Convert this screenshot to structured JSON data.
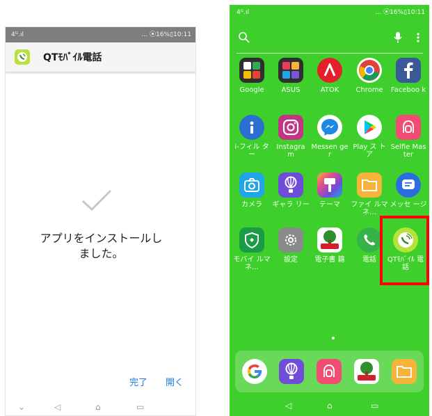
{
  "left": {
    "status_left": "4ᴳ.ıl",
    "status_right": "… ⦿16%▯10:11",
    "app_title": "QTﾓﾊﾞｲﾙ電話",
    "message_line1": "アプリをインストールし",
    "message_line2": "ました。",
    "done_label": "完了",
    "open_label": "開く",
    "nav": [
      "⌄",
      "◁",
      "⌂",
      "▭"
    ]
  },
  "right": {
    "status_left": "4ᴳ.ıl",
    "status_right": "… ⦿16%▯10:11",
    "apps": [
      {
        "label": "Google",
        "color": "#2f2f2f",
        "icon": "google-folder-icon"
      },
      {
        "label": "ASUS",
        "color": "#2f2f2f",
        "icon": "asus-folder-icon"
      },
      {
        "label": "ATOK",
        "color": "#e4202d",
        "icon": "atok-icon"
      },
      {
        "label": "Chrome",
        "color": "#ffffff",
        "icon": "chrome-icon"
      },
      {
        "label": "Faceboo k",
        "color": "#3b5998",
        "icon": "facebook-icon"
      },
      {
        "label": "i-フィル ター",
        "color": "#2b6fd1",
        "icon": "i-filter-icon"
      },
      {
        "label": "Instagra m",
        "color": "#c13584",
        "icon": "instagram-icon"
      },
      {
        "label": "Messen ger",
        "color": "#1e88e5",
        "icon": "messenger-icon"
      },
      {
        "label": "Play ス トア",
        "color": "#ffffff",
        "icon": "play-store-icon"
      },
      {
        "label": "Selfie Master",
        "color": "#f24b74",
        "icon": "selfie-master-icon"
      },
      {
        "label": "カメラ",
        "color": "#1ea6e8",
        "icon": "camera-icon"
      },
      {
        "label": "ギャラ リー",
        "color": "#6f4dd8",
        "icon": "gallery-icon"
      },
      {
        "label": "テーマ",
        "color": "#e64b8c",
        "icon": "theme-icon"
      },
      {
        "label": "ファイ ルマネ…",
        "color": "#f6b43a",
        "icon": "file-manager-icon"
      },
      {
        "label": "メッセ ージ",
        "color": "#2a6de0",
        "icon": "messages-icon"
      },
      {
        "label": "モバイ ルマネ…",
        "color": "#1a9b46",
        "icon": "mobile-manager-icon"
      },
      {
        "label": "設定",
        "color": "#8a8a8a",
        "icon": "settings-icon"
      },
      {
        "label": "電子書 籍",
        "color": "#ffffff",
        "icon": "ebook-icon"
      },
      {
        "label": "電話",
        "color": "#36b24a",
        "icon": "phone-icon"
      },
      {
        "label": "QTﾓﾊﾞｲﾙ 電話",
        "color": "#b8e23a",
        "icon": "qt-mobile-phone-icon"
      }
    ],
    "dock": [
      {
        "icon": "google-icon",
        "color": "#ffffff"
      },
      {
        "icon": "gallery-icon",
        "color": "#6f4dd8"
      },
      {
        "icon": "selfie-master-icon",
        "color": "#f24b74"
      },
      {
        "icon": "ebook-icon",
        "color": "#ffffff"
      },
      {
        "icon": "file-manager-icon",
        "color": "#f6b43a"
      }
    ],
    "nav": [
      "◁",
      "⌂",
      "▭"
    ],
    "highlight_color": "#ff0000",
    "background_color": "#3fcf2c"
  }
}
